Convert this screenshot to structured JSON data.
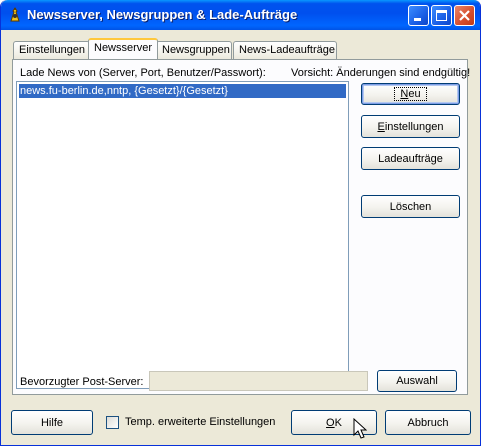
{
  "window": {
    "title": "Newsserver, Newsgruppen & Lade-Aufträge"
  },
  "tabs": [
    {
      "label": "Einstellungen"
    },
    {
      "label": "Newsserver"
    },
    {
      "label": "Newsgruppen"
    },
    {
      "label": "News-Ladeaufträge"
    }
  ],
  "newsserver": {
    "list_label": "Lade News von (Server, Port, Benutzer/Passwort):",
    "warning": "Vorsicht: Änderungen sind endgültig!",
    "servers": [
      "news.fu-berlin.de,nntp, {Gesetzt}/{Gesetzt}"
    ],
    "buttons": {
      "new": "Neu",
      "settings": "Einstellungen",
      "jobs": "Ladeaufträge",
      "delete": "Löschen"
    },
    "post_server_label": "Bevorzugter Post-Server:",
    "post_server_value": "",
    "select_button": "Auswahl"
  },
  "footer": {
    "help": "Hilfe",
    "temp_settings_label": "Temp. erweiterte Einstellungen",
    "temp_settings_checked": false,
    "ok": "OK",
    "cancel": "Abbruch"
  }
}
